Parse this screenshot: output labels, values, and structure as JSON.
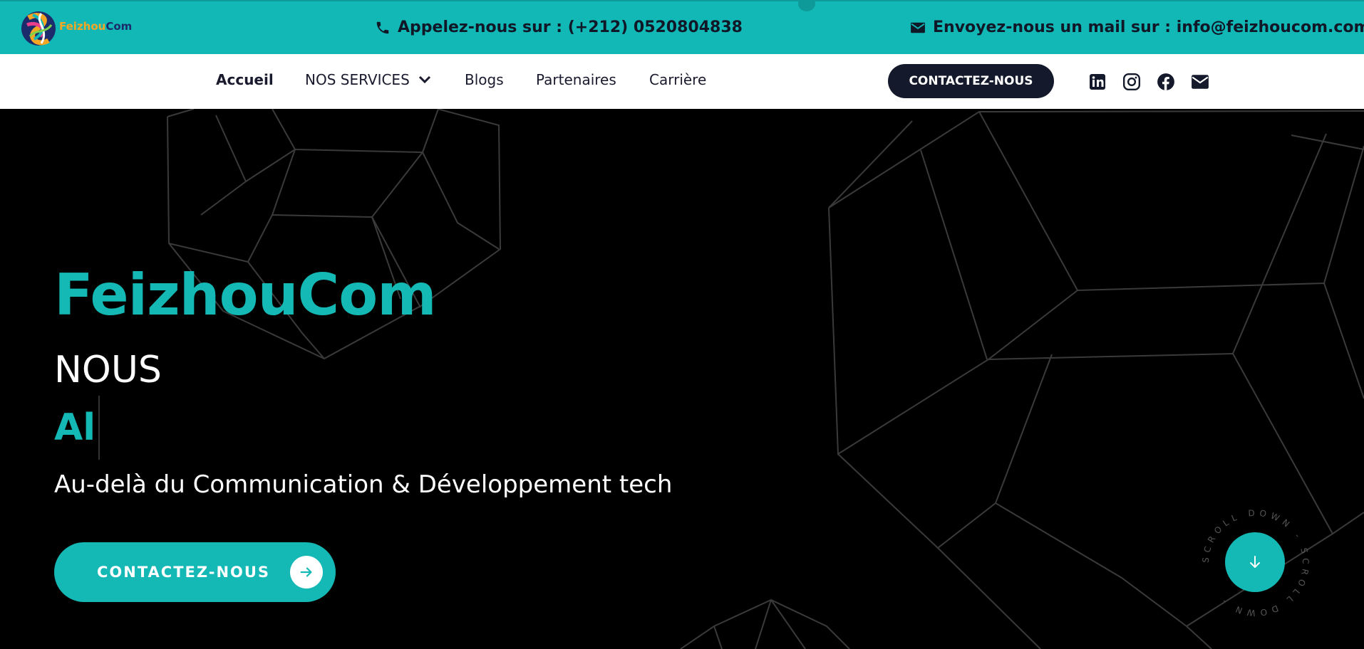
{
  "topbar": {
    "logo_part1": "Feizhou",
    "logo_part2": "Com",
    "phone_text": "Appelez-nous sur : (+212) 0520804838",
    "email_text": "Envoyez-nous un mail sur : info@feizhoucom.com",
    "phone_icon": "phone-icon",
    "email_icon": "envelope-icon"
  },
  "nav": {
    "items": [
      "Accueil",
      "NOS SERVICES",
      "Blogs",
      "Partenaires",
      "Carrière"
    ],
    "active": "Accueil",
    "cta_label": "CONTACTEZ-NOUS",
    "social_icons": [
      "linkedin-icon",
      "instagram-icon",
      "facebook-icon",
      "mail-icon"
    ]
  },
  "hero": {
    "brand": "FeizhouCom",
    "line1": "NOUS",
    "typed_text": "Al",
    "tagline": "Au-delà du Communication & Développement tech",
    "cta_label": "CONTACTEZ-NOUS",
    "scroll_text": "SCROLL DOWN - SCROLL DOWN - "
  },
  "colors": {
    "accent": "#14b8b4",
    "topbar": "#12b8b6",
    "dark": "#141a2b",
    "background": "#000000"
  }
}
